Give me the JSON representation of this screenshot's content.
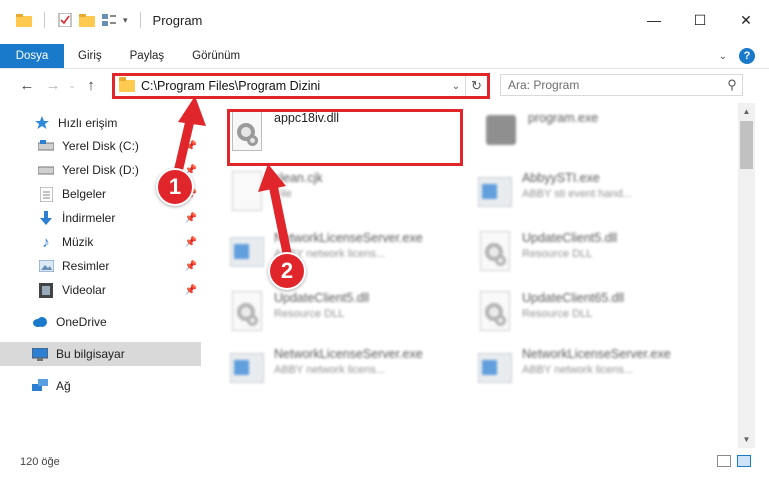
{
  "window": {
    "title": "Program",
    "min_glyph": "—",
    "max_glyph": "☐",
    "close_glyph": "✕"
  },
  "ribbon": {
    "tabs": [
      "Dosya",
      "Giriş",
      "Paylaş",
      "Görünüm"
    ],
    "collapse_glyph": "⌄",
    "help_glyph": "?"
  },
  "nav": {
    "back_glyph": "←",
    "forward_glyph": "→",
    "up_glyph": "↑",
    "address": "C:\\Program Files\\Program Dizini",
    "dropdown_glyph": "⌄",
    "refresh_glyph": "↻",
    "search_placeholder": "Ara: Program",
    "search_glyph": "⚲"
  },
  "sidebar": {
    "items": [
      {
        "label": "Hızlı erişim",
        "icon": "star-icon",
        "pinned": false
      },
      {
        "label": "Yerel Disk (C:)",
        "icon": "drive-icon",
        "pinned": true
      },
      {
        "label": "Yerel Disk (D:)",
        "icon": "drive-icon",
        "pinned": true
      },
      {
        "label": "Belgeler",
        "icon": "documents-icon",
        "pinned": true
      },
      {
        "label": "İndirmeler",
        "icon": "download-icon",
        "pinned": true
      },
      {
        "label": "Müzik",
        "icon": "music-icon",
        "pinned": true
      },
      {
        "label": "Resimler",
        "icon": "pictures-icon",
        "pinned": true
      },
      {
        "label": "Videolar",
        "icon": "video-icon",
        "pinned": true
      },
      {
        "label": "OneDrive",
        "icon": "cloud-icon",
        "pinned": false
      },
      {
        "label": "Bu bilgisayar",
        "icon": "computer-icon",
        "pinned": false
      },
      {
        "label": "Ağ",
        "icon": "network-icon",
        "pinned": false
      }
    ],
    "pin_glyph": "📌"
  },
  "files": [
    {
      "name": "appc18iv.dll",
      "desc": "",
      "icon": "dll-icon"
    },
    {
      "name": "program.exe",
      "desc": "",
      "icon": "exe-icon"
    },
    {
      "name": "clean.cjk",
      "desc": "File",
      "icon": "file-icon"
    },
    {
      "name": "AbbyySTI.exe",
      "desc": "ABBY sti event hand...",
      "icon": "app-icon"
    },
    {
      "name": "NetworkLicenseServer.exe",
      "desc": "ABBY network licens...",
      "icon": "app-icon"
    },
    {
      "name": "UpdateClient5.dll",
      "desc": "Resource DLL",
      "icon": "dll-icon"
    },
    {
      "name": "UpdateClient5.dll",
      "desc": "Resource DLL",
      "icon": "dll-icon"
    },
    {
      "name": "UpdateClient65.dll",
      "desc": "Resource DLL",
      "icon": "dll-icon"
    },
    {
      "name": "NetworkLicenseServer.exe",
      "desc": "ABBY network licens...",
      "icon": "app-icon"
    },
    {
      "name": "NetworkLicenseServer.exe",
      "desc": "ABBY network licens...",
      "icon": "app-icon"
    }
  ],
  "status": {
    "count": "120 öğe"
  },
  "callouts": [
    "1",
    "2"
  ],
  "colors": {
    "accent": "#1979ca",
    "highlight": "#e0262b"
  }
}
